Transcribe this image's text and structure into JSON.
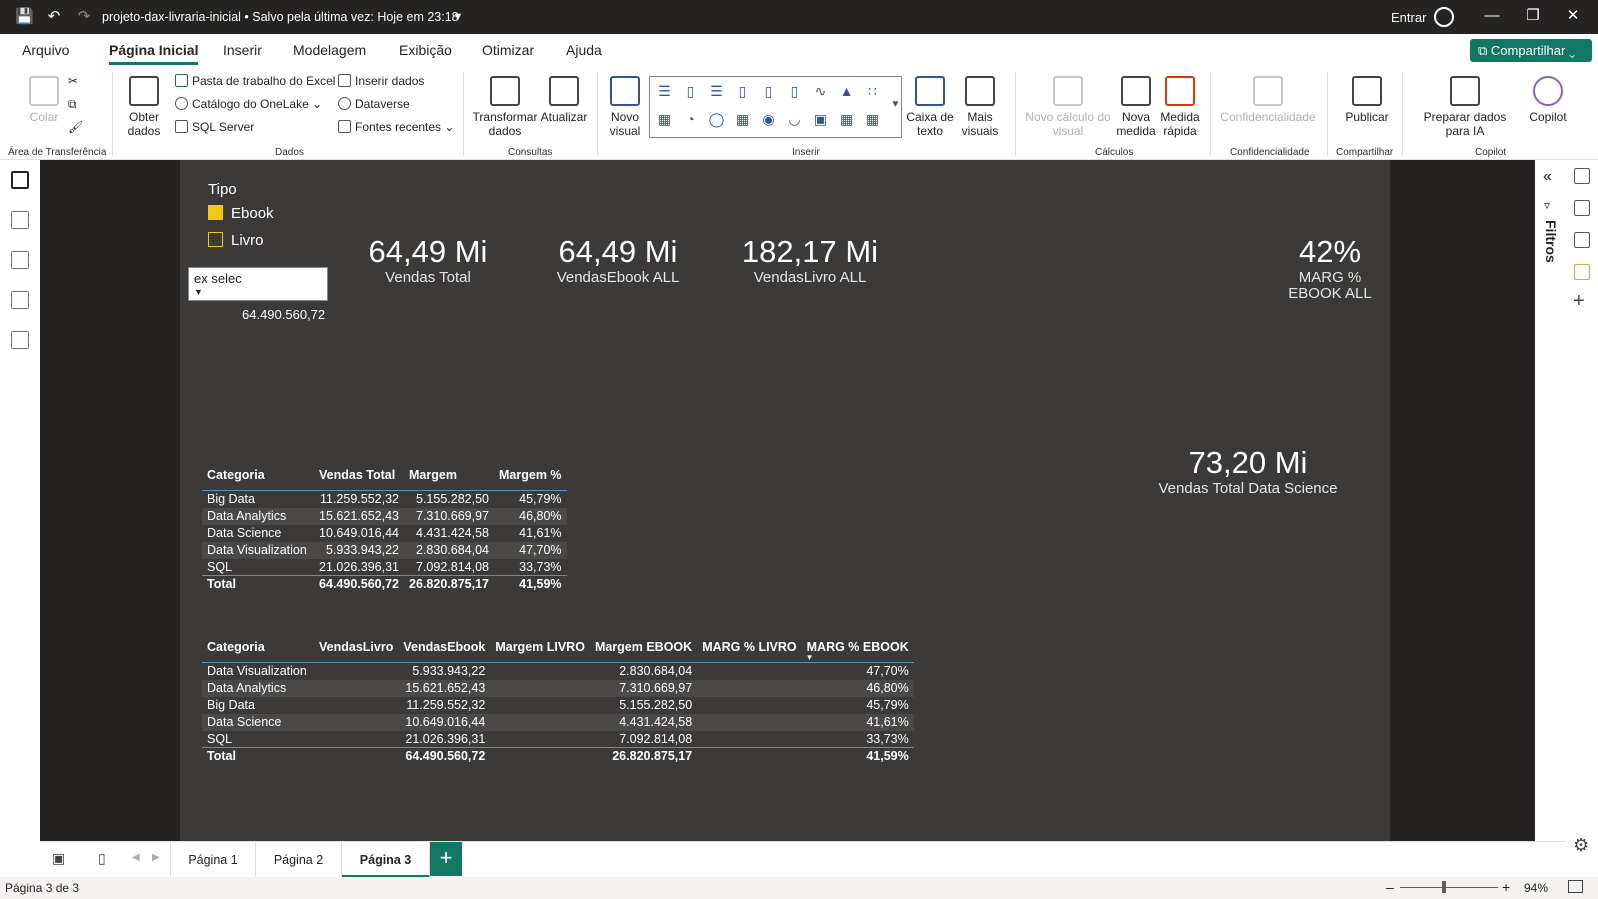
{
  "titlebar": {
    "title": "projeto-dax-livraria-inicial • Salvo pela última vez: Hoje em 23:18",
    "signin": "Entrar"
  },
  "menu": {
    "items": [
      "Arquivo",
      "Página Inicial",
      "Inserir",
      "Modelagem",
      "Exibição",
      "Otimizar",
      "Ajuda"
    ],
    "share": "Compartilhar"
  },
  "ribbon": {
    "clipboard": {
      "paste": "Colar",
      "label": "Área de Transferência"
    },
    "data": {
      "get_data": "Obter dados",
      "excel": "Pasta de trabalho do Excel",
      "onelake": "Catálogo do OneLake",
      "sql": "SQL Server",
      "enter_data": "Inserir dados",
      "dataverse": "Dataverse",
      "recent": "Fontes recentes",
      "label": "Dados"
    },
    "queries": {
      "transform": "Transformar dados",
      "refresh": "Atualizar",
      "label": "Consultas"
    },
    "insert": {
      "new_visual": "Novo visual",
      "text_box": "Caixa de texto",
      "more_visuals": "Mais visuais",
      "label": "Inserir"
    },
    "calc": {
      "new_visual_calc": "Novo cálculo do visual",
      "new_measure": "Nova medida",
      "quick_measure": "Medida rápida",
      "label": "Cálculos"
    },
    "sensitivity": {
      "btn": "Confidencialidade",
      "label": "Confidencialidade"
    },
    "share": {
      "publish": "Publicar",
      "label": "Compartilhar"
    },
    "copilot": {
      "prepare": "Preparar dados para IA",
      "copilot": "Copilot",
      "label": "Copilot"
    }
  },
  "filters_pane": {
    "label": "Filtros"
  },
  "slicer": {
    "title": "Tipo",
    "items": [
      {
        "label": "Ebook",
        "checked": true
      },
      {
        "label": "Livro",
        "checked": false
      }
    ]
  },
  "dropdown": {
    "value": "ex selec",
    "result": "64.490.560,72"
  },
  "cards": [
    {
      "value": "64,49 Mi",
      "label": "Vendas Total"
    },
    {
      "value": "64,49 Mi",
      "label": "VendasEbook ALL"
    },
    {
      "value": "182,17 Mi",
      "label": "VendasLivro ALL"
    },
    {
      "value": "42%",
      "label": "MARG % EBOOK ALL"
    },
    {
      "value": "73,20 Mi",
      "label": "Vendas Total Data Science"
    }
  ],
  "table1": {
    "headers": [
      "Categoria",
      "Vendas Total",
      "Margem",
      "Margem %"
    ],
    "rows": [
      [
        "Big Data",
        "11.259.552,32",
        "5.155.282,50",
        "45,79%"
      ],
      [
        "Data Analytics",
        "15.621.652,43",
        "7.310.669,97",
        "46,80%"
      ],
      [
        "Data Science",
        "10.649.016,44",
        "4.431.424,58",
        "41,61%"
      ],
      [
        "Data Visualization",
        "5.933.943,22",
        "2.830.684,04",
        "47,70%"
      ],
      [
        "SQL",
        "21.026.396,31",
        "7.092.814,08",
        "33,73%"
      ]
    ],
    "total": [
      "Total",
      "64.490.560,72",
      "26.820.875,17",
      "41,59%"
    ]
  },
  "table2": {
    "headers": [
      "Categoria",
      "VendasLivro",
      "VendasEbook",
      "Margem LIVRO",
      "Margem EBOOK",
      "MARG % LIVRO",
      "MARG % EBOOK"
    ],
    "rows": [
      [
        "Data Visualization",
        "",
        "5.933.943,22",
        "",
        "2.830.684,04",
        "",
        "47,70%"
      ],
      [
        "Data Analytics",
        "",
        "15.621.652,43",
        "",
        "7.310.669,97",
        "",
        "46,80%"
      ],
      [
        "Big Data",
        "",
        "11.259.552,32",
        "",
        "5.155.282,50",
        "",
        "45,79%"
      ],
      [
        "Data Science",
        "",
        "10.649.016,44",
        "",
        "4.431.424,58",
        "",
        "41,61%"
      ],
      [
        "SQL",
        "",
        "21.026.396,31",
        "",
        "7.092.814,08",
        "",
        "33,73%"
      ]
    ],
    "total": [
      "Total",
      "",
      "64.490.560,72",
      "",
      "26.820.875,17",
      "",
      "41,59%"
    ]
  },
  "pages": {
    "tabs": [
      "Página 1",
      "Página 2",
      "Página 3"
    ],
    "active": "Página 3"
  },
  "status": {
    "page": "Página 3 de 3",
    "zoom": "94%"
  }
}
